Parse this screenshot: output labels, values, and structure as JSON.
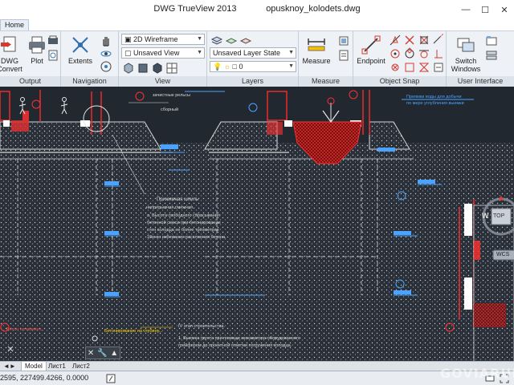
{
  "app": {
    "title": "DWG TrueView 2013",
    "filename": "opusknoy_kolodets.dwg"
  },
  "window_controls": {
    "minimize": "—",
    "maximize": "☐",
    "close": "✕"
  },
  "tabs": {
    "home": "Home"
  },
  "ribbon": {
    "output": {
      "label": "Output",
      "dwg_convert": "DWG\nConvert",
      "plot": "Plot"
    },
    "navigation": {
      "label": "Navigation",
      "extents": "Extents"
    },
    "view": {
      "label": "View",
      "visual_style": "2D Wireframe",
      "saved_view": "Unsaved View"
    },
    "layers": {
      "label": "Layers",
      "layer_state": "Unsaved Layer State",
      "layer_current": "0"
    },
    "measure": {
      "label": "Measure",
      "measure_btn": "Measure"
    },
    "object_snap": {
      "label": "Object Snap",
      "endpoint": "Endpoint"
    },
    "user_interface": {
      "label": "User Interface",
      "switch_windows": "Switch\nWindows"
    }
  },
  "viewcube": {
    "west": "W",
    "top": "TOP",
    "wcs": "WCS"
  },
  "layout_tabs": {
    "model": "Model",
    "sheet1": "Лист1",
    "sheet2": "Лист2"
  },
  "status": {
    "coordinates": "2595, 227499.4266, 0.0000"
  },
  "watermark": "GOVIARUM",
  "drawing_notes": {
    "note1": "Прижимная шпиль",
    "note2": "непрерывная смежная",
    "note3": "забивных балок",
    "note4": "а. Высота свободного сбрасывания",
    "note5": "бетонной смеси при бетонировании",
    "note6": "стен колодца не более трёхметров",
    "note7": "10м во избежание расслоения бетона.",
    "stage": "IV этап строительства.",
    "stage_text1": "1. Выемка грунта при помощи экскаватора оборудованного",
    "stage_text2": "грейфером до проектной отметки погружения колодца.",
    "label_left1": "Бетонирование на глубину...",
    "label_left2": "Бетон на момент...",
    "top_label1": "Приямки воды для добычи",
    "top_label2": "по мере углубления выемки",
    "top_note": "зачистные рельсы",
    "top_note2": "сборный"
  }
}
